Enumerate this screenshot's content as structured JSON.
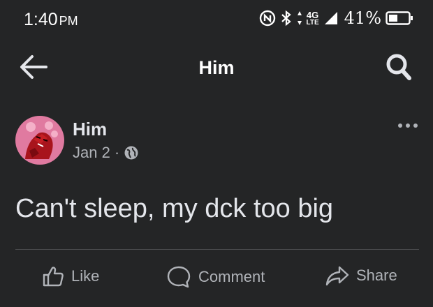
{
  "status_bar": {
    "time": "1:40",
    "ampm": "PM",
    "network": "4G",
    "network_sub": "LTE",
    "battery": "41%"
  },
  "app_bar": {
    "title": "Him",
    "icons": {
      "back": "arrow-left-icon",
      "search": "search-icon"
    }
  },
  "post": {
    "author": "Him",
    "date": "Jan 2",
    "separator": "·",
    "privacy_icon": "globe-icon",
    "text": "Can't sleep, my dck too big"
  },
  "actions": {
    "like": "Like",
    "comment": "Comment",
    "share": "Share"
  },
  "colors": {
    "background": "#242526",
    "text_primary": "#e4e6eb",
    "text_secondary": "#b0b3b8",
    "avatar_bg": "#e07aa0"
  }
}
